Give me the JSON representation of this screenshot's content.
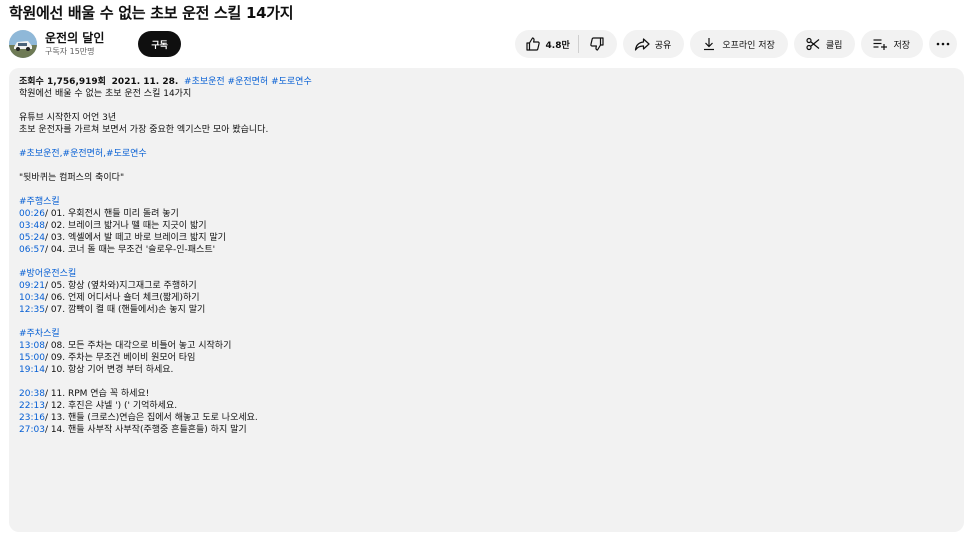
{
  "video": {
    "title": "학원에선 배울 수 없는 초보 운전 스킬 14가지"
  },
  "channel": {
    "name": "운전의 달인",
    "subscribers": "구독자 15만명",
    "subscribe_label": "구독"
  },
  "actions": {
    "like_count": "4.8만",
    "share_label": "공유",
    "download_label": "오프라인 저장",
    "clip_label": "클립",
    "save_label": "저장"
  },
  "description": {
    "views": "조회수 1,756,919회",
    "date": "2021. 11. 28.",
    "header_tags": "#초보운전 #운전면허 #도로연수",
    "line1": "학원에선 배울 수 없는 초보 운전 스킬 14가지",
    "line2": "유튜브 시작한지 어언 3년",
    "line3": "초보 운전자를 가르쳐 보면서 가장 중요한 엑기스만 모아 봤습니다.",
    "tags_line": "#초보운전,#운전면허,#도로연수",
    "quote": "\"뒷바퀴는 컴퍼스의 축이다\"",
    "sections": [
      {
        "heading": "#주행스킬",
        "items": [
          {
            "time": "00:26",
            "text": "/ 01. 우회전시 핸들 미리 돌려 놓기"
          },
          {
            "time": "03:48",
            "text": "/ 02. 브레이크 밟거나 뗄 때는 지긋이 밟기"
          },
          {
            "time": "05:24",
            "text": "/ 03. 엑셀에서 발 떼고 바로 브레이크 밟지 말기"
          },
          {
            "time": "06:57",
            "text": "/ 04. 코너 돌 때는 무조건 '슬로우-인-패스트'"
          }
        ]
      },
      {
        "heading": "#방어운전스킬",
        "items": [
          {
            "time": "09:21",
            "text": "/ 05. 항상 (옆차와)지그재그로 주행하기"
          },
          {
            "time": "10:34",
            "text": "/ 06. 언제 어디서나 숄더 체크(짧게)하기"
          },
          {
            "time": "12:35",
            "text": "/ 07. 깜빡이 켤 때 (핸들에서)손 놓지 말기"
          }
        ]
      },
      {
        "heading": "#주차스킬",
        "items": [
          {
            "time": "13:08",
            "text": "/ 08. 모든 주차는 대각으로 비틀어 놓고 시작하기"
          },
          {
            "time": "15:00",
            "text": "/ 09. 주차는 무조건 베이비 원모어 타임"
          },
          {
            "time": "19:14",
            "text": "/ 10. 항상 기어 변경 부터 하세요."
          }
        ]
      },
      {
        "heading": "",
        "items": [
          {
            "time": "20:38",
            "text": "/ 11. RPM 연습 꼭 하세요!"
          },
          {
            "time": "22:13",
            "text": "/ 12. 후진은 샤넬 ') (' 기억하세요."
          },
          {
            "time": "23:16",
            "text": "/ 13. 핸들 (크로스)연습은 집에서 해놓고 도로 나오세요."
          },
          {
            "time": "27:03",
            "text": "/ 14. 핸들 사부작 사부작(주행중 흔들흔들) 하지 말기"
          }
        ]
      }
    ]
  },
  "colors": {
    "link": "#065fd4",
    "subscribe_bg": "#0f0f0f",
    "pill_bg": "#f2f2f2"
  },
  "icons": [
    "thumbs-up-icon",
    "thumbs-down-icon",
    "share-icon",
    "download-icon",
    "scissors-icon",
    "playlist-add-icon",
    "more-icon"
  ]
}
